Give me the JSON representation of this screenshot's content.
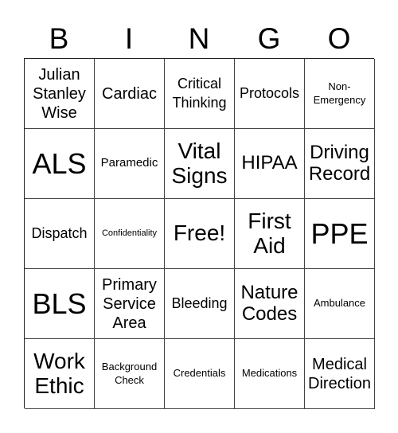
{
  "header": [
    "B",
    "I",
    "N",
    "G",
    "O"
  ],
  "cells": [
    {
      "text": "Julian Stanley Wise",
      "size": "s-m"
    },
    {
      "text": "Cardiac",
      "size": "s-m"
    },
    {
      "text": "Critical Thinking",
      "size": "s-ms"
    },
    {
      "text": "Protocols",
      "size": "s-ms"
    },
    {
      "text": "Non- Emergency",
      "size": "s-xs"
    },
    {
      "text": "ALS",
      "size": "s-xl"
    },
    {
      "text": "Paramedic",
      "size": "s-s"
    },
    {
      "text": "Vital Signs",
      "size": "s-l"
    },
    {
      "text": "HIPAA",
      "size": "s-lm"
    },
    {
      "text": "Driving Record",
      "size": "s-lm"
    },
    {
      "text": "Dispatch",
      "size": "s-ms"
    },
    {
      "text": "Confidentiality",
      "size": "s-xxs"
    },
    {
      "text": "Free!",
      "size": "s-l"
    },
    {
      "text": "First Aid",
      "size": "s-l"
    },
    {
      "text": "PPE",
      "size": "s-xl"
    },
    {
      "text": "BLS",
      "size": "s-xl"
    },
    {
      "text": "Primary Service Area",
      "size": "s-m"
    },
    {
      "text": "Bleeding",
      "size": "s-ms"
    },
    {
      "text": "Nature Codes",
      "size": "s-lm"
    },
    {
      "text": "Ambulance",
      "size": "s-xs"
    },
    {
      "text": "Work Ethic",
      "size": "s-l"
    },
    {
      "text": "Background Check",
      "size": "s-xs"
    },
    {
      "text": "Credentials",
      "size": "s-xs"
    },
    {
      "text": "Medications",
      "size": "s-xs"
    },
    {
      "text": "Medical Direction",
      "size": "s-m"
    }
  ]
}
